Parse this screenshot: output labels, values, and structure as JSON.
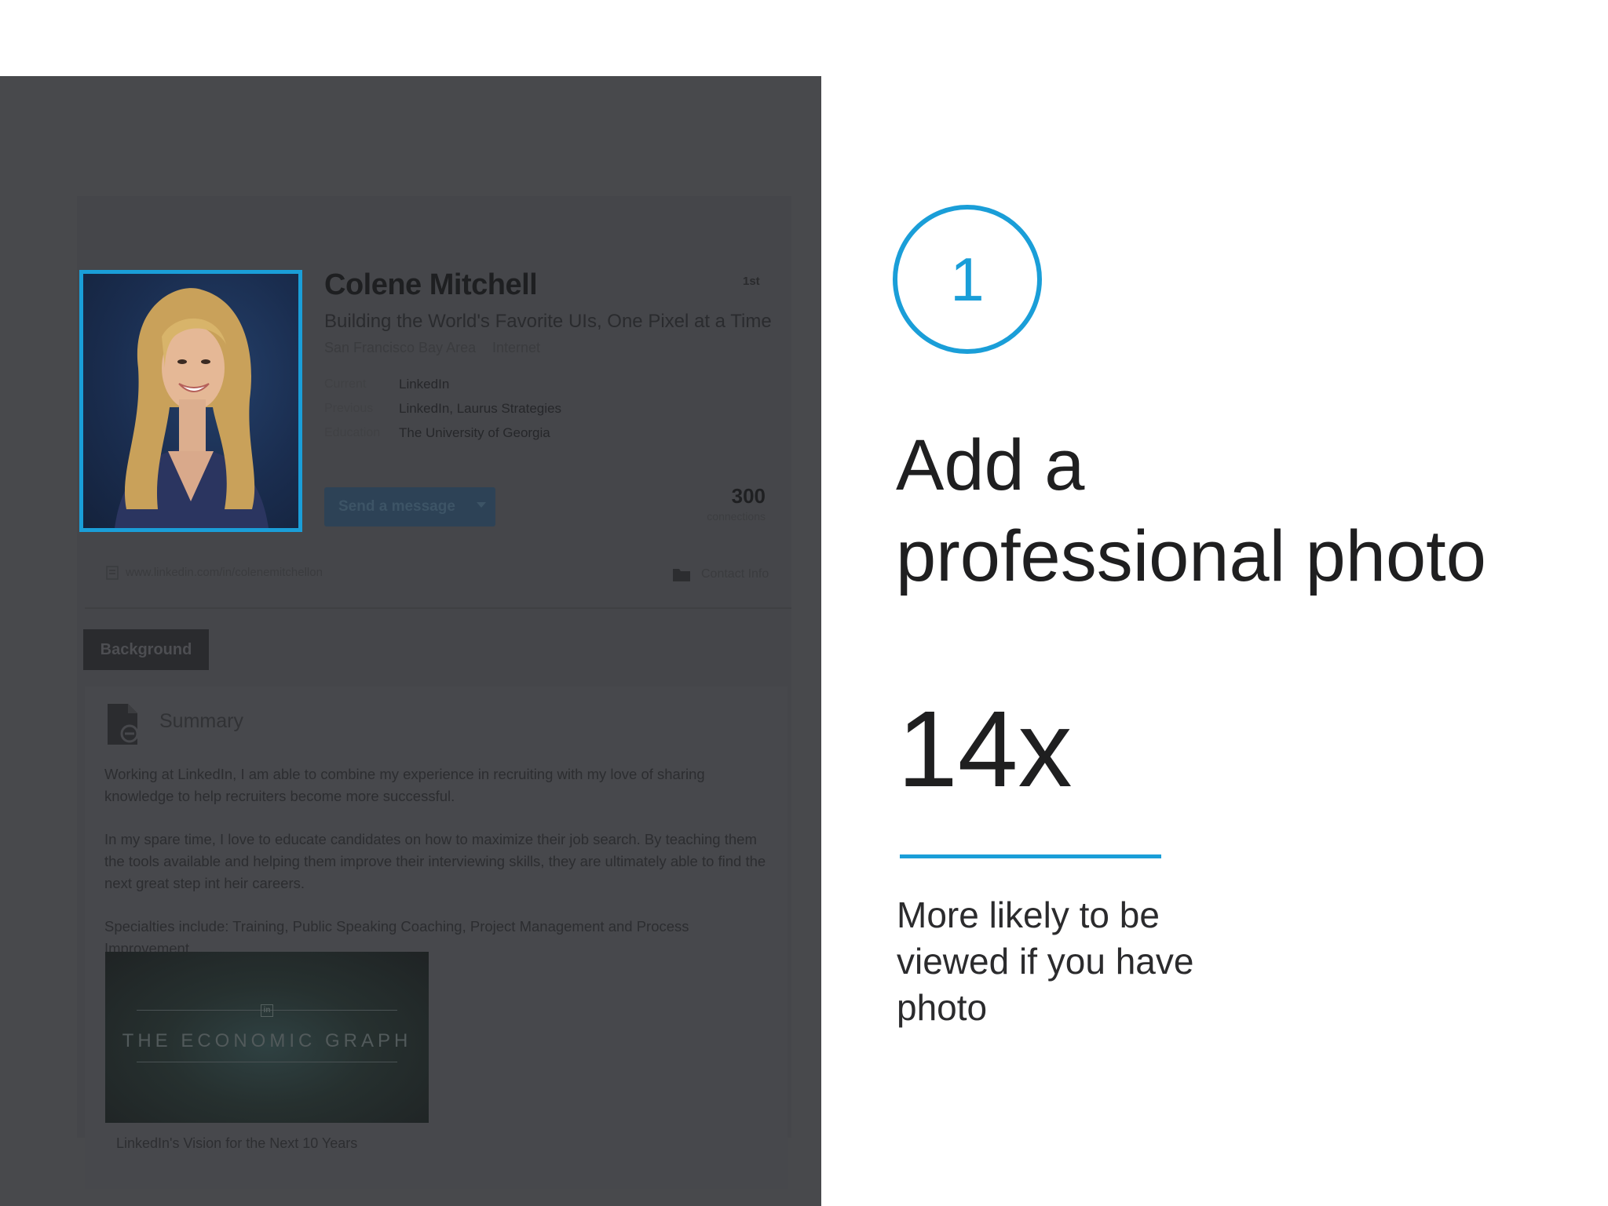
{
  "profile": {
    "name": "Colene Mitchell",
    "degree": "1st",
    "headline": "Building the World's Favorite UIs, One Pixel at a Time",
    "location": "San Francisco Bay Area",
    "industry": "Internet",
    "details": [
      {
        "label": "Current",
        "value": "LinkedIn"
      },
      {
        "label": "Previous",
        "value": "LinkedIn, Laurus Strategies"
      },
      {
        "label": "Education",
        "value": "The University of Georgia"
      }
    ],
    "send_button_label": "Send a message",
    "connections_count": "300",
    "connections_label": "connections",
    "profile_url": "www.linkedin.com/in/colenemitchellon",
    "contact_info_label": "Contact Info"
  },
  "background_tab": "Background",
  "summary": {
    "title": "Summary",
    "paragraphs": [
      "Working at LinkedIn, I am able to combine my experience in recruiting with my love of sharing knowledge to help recruiters become more successful.",
      "In my spare time, I love to educate candidates on how to maximize their job search. By teaching them the tools available and helping them improve their interviewing skills, they are ultimately able to find the next great step int heir careers.",
      "Specialties include: Training, Public Speaking Coaching, Project Management and Process Improvement."
    ],
    "media": {
      "logo_text": "in",
      "title": "THE ECONOMIC GRAPH",
      "caption": "LinkedIn's Vision for the Next 10 Years"
    }
  },
  "tip": {
    "step_number": "1",
    "heading_line1": "Add a",
    "heading_line2": "professional photo",
    "stat_value": "14x",
    "stat_caption_line1": "More likely to be",
    "stat_caption_line2": "viewed if you have",
    "stat_caption_line3": "photo"
  },
  "colors": {
    "accent": "#1a9ed8",
    "overlay": "#48494c",
    "text_dark": "#1f1f20"
  },
  "icons": {
    "profile_photo": "profile-photo",
    "url": "link-icon",
    "contact": "folder-icon",
    "summary": "document-icon"
  }
}
